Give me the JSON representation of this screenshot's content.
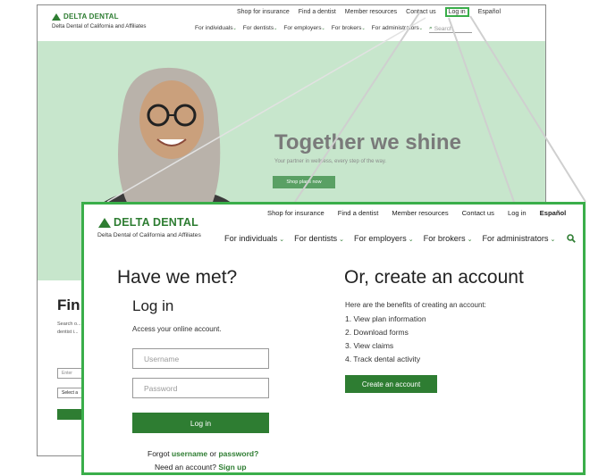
{
  "brand": {
    "logo_text": "DELTA DENTAL",
    "subtitle": "Delta Dental of California and Affiliates"
  },
  "utility_nav": [
    "Shop for insurance",
    "Find a dentist",
    "Member resources",
    "Contact us",
    "Log in",
    "Español"
  ],
  "main_nav": [
    "For individuals",
    "For dentists",
    "For employers",
    "For brokers",
    "For administrators"
  ],
  "background_page": {
    "search_placeholder": "Search",
    "hero_title": "Together we shine",
    "hero_subtitle": "Your partner in wellness, every step of the way.",
    "hero_button": "Shop plans now",
    "find_heading": "Fin",
    "find_text": "Search o... that's ri... dentist i...",
    "input_placeholder": "Enter",
    "select_value": "Select a"
  },
  "login": {
    "heading": "Have we met?",
    "subheading": "Log in",
    "description": "Access your online account.",
    "username_placeholder": "Username",
    "password_placeholder": "Password",
    "login_button": "Log in",
    "forgot_prefix": "Forgot",
    "forgot_username": "username",
    "forgot_or": "or",
    "forgot_password": "password?",
    "need_account": "Need an account?",
    "sign_up": "Sign up"
  },
  "create": {
    "heading": "Or, create an account",
    "benefits_intro": "Here are the benefits of creating an account:",
    "benefits": [
      "1.  View plan information",
      "2.  Download forms",
      "3.  View claims",
      "4.  Track dental activity"
    ],
    "button": "Create an account"
  },
  "colors": {
    "brand_green": "#2e7d32",
    "callout_border": "#3aae4a",
    "hero_bg": "#c7e6cc"
  }
}
